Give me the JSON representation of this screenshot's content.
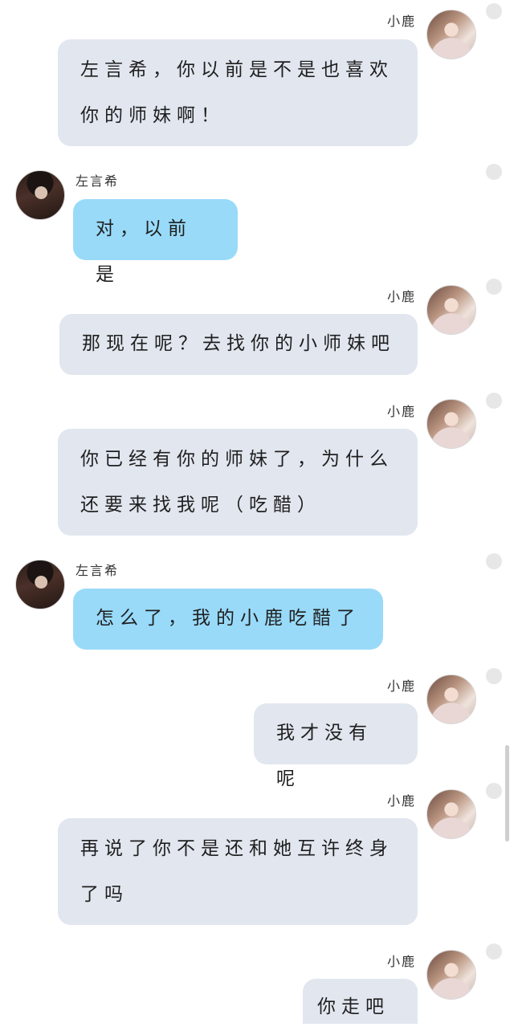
{
  "chat": {
    "messages": [
      {
        "sender": "小鹿",
        "side": "right",
        "text": "左言希，你以前是不是也喜欢你的师妹啊！"
      },
      {
        "sender": "左言希",
        "side": "left",
        "text": "对，以前是"
      },
      {
        "sender": "小鹿",
        "side": "right",
        "text": "那现在呢？去找你的小师妹吧"
      },
      {
        "sender": "小鹿",
        "side": "right",
        "text": "你已经有你的师妹了，为什么还要来找我呢（吃醋）"
      },
      {
        "sender": "左言希",
        "side": "left",
        "text": "怎么了，我的小鹿吃醋了"
      },
      {
        "sender": "小鹿",
        "side": "right",
        "text": "我才没有呢"
      },
      {
        "sender": "小鹿",
        "side": "right",
        "text": "再说了你不是还和她互许终身了吗"
      },
      {
        "sender": "小鹿",
        "side": "right",
        "text": "你走吧"
      }
    ]
  },
  "colors": {
    "my_bubble": "#e1e6ef",
    "other_bubble": "#99daf9",
    "background": "#ffffff"
  },
  "icons": {
    "girl_avatar": "avatar-xiaolu",
    "boy_avatar": "avatar-zuoyanxi",
    "status_dot": "circle-dot-icon"
  }
}
